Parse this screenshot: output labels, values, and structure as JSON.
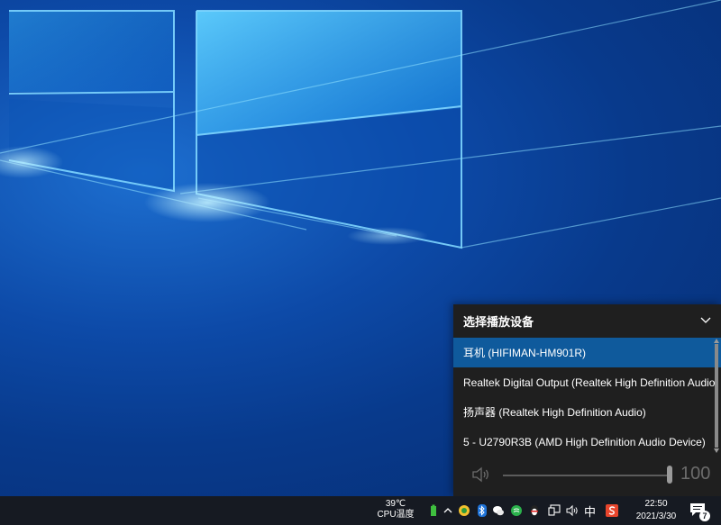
{
  "flyout": {
    "title": "选择播放设备",
    "devices": [
      {
        "label": "耳机 (HIFIMAN-HM901R)",
        "selected": true
      },
      {
        "label": "Realtek Digital Output (Realtek High Definition Audio)",
        "selected": false
      },
      {
        "label": "扬声器 (Realtek High Definition Audio)",
        "selected": false
      },
      {
        "label": "5 - U2790R3B (AMD High Definition Audio Device)",
        "selected": false
      }
    ],
    "volume": {
      "value": "100",
      "level_percent": 100
    }
  },
  "taskbar": {
    "cpu_temp_value": "39℃",
    "cpu_temp_label": "CPU温度",
    "ime": "中",
    "clock_time": "22:50",
    "clock_date": "2021/3/30",
    "notification_count": "7"
  },
  "colors": {
    "accent": "#0f5a9c",
    "flyout_bg": "#1f1f1f",
    "taskbar_bg": "#161a22"
  }
}
